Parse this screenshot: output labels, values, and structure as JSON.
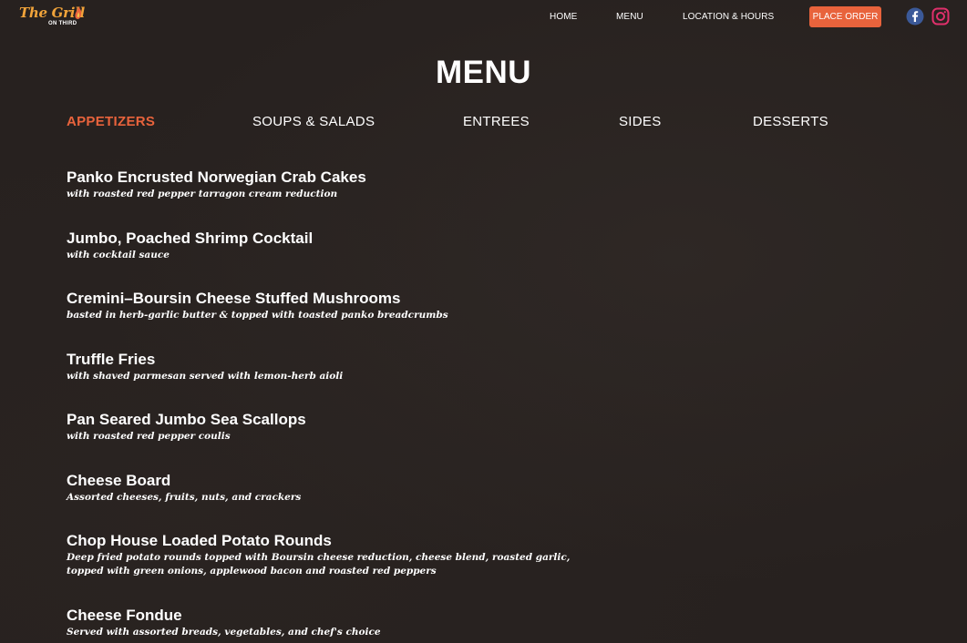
{
  "header": {
    "logo_main": "The Grill",
    "logo_sub": "ON THIRD",
    "nav": [
      "HOME",
      "MENU",
      "LOCATION & HOURS"
    ],
    "order_label": "PLACE ORDER",
    "colors": {
      "accent": "#e8633c",
      "logo": "#f2a43a",
      "background": "#27211f",
      "facebook": "#3b5998",
      "instagram": "#e1306c"
    }
  },
  "page": {
    "title": "MENU"
  },
  "tabs": [
    "APPETIZERS",
    "SOUPS & SALADS",
    "ENTREES",
    "SIDES",
    "DESSERTS"
  ],
  "active_tab": "APPETIZERS",
  "items": [
    {
      "name": "Panko Encrusted Norwegian Crab Cakes",
      "desc": [
        "with roasted red pepper tarragon cream reduction"
      ]
    },
    {
      "name": "Jumbo, Poached Shrimp Cocktail",
      "desc": [
        "with cocktail sauce"
      ]
    },
    {
      "name": "Cremini–Boursin Cheese Stuffed Mushrooms",
      "desc": [
        "basted in herb-garlic butter & topped with toasted panko breadcrumbs"
      ]
    },
    {
      "name": "Truffle Fries",
      "desc": [
        "with shaved parmesan served with lemon-herb aioli"
      ]
    },
    {
      "name": "Pan Seared Jumbo Sea Scallops",
      "desc": [
        "with roasted red pepper coulis"
      ]
    },
    {
      "name": "Cheese Board",
      "desc": [
        "Assorted cheeses, fruits, nuts, and crackers"
      ]
    },
    {
      "name": "Chop House Loaded Potato Rounds",
      "desc": [
        "Deep fried potato rounds topped with Boursin cheese reduction, cheese blend, roasted garlic,",
        "topped with green onions, applewood bacon and roasted red peppers"
      ]
    },
    {
      "name": "Cheese Fondue",
      "desc": [
        "Served with assorted breads, vegetables, and chef's choice"
      ]
    }
  ]
}
